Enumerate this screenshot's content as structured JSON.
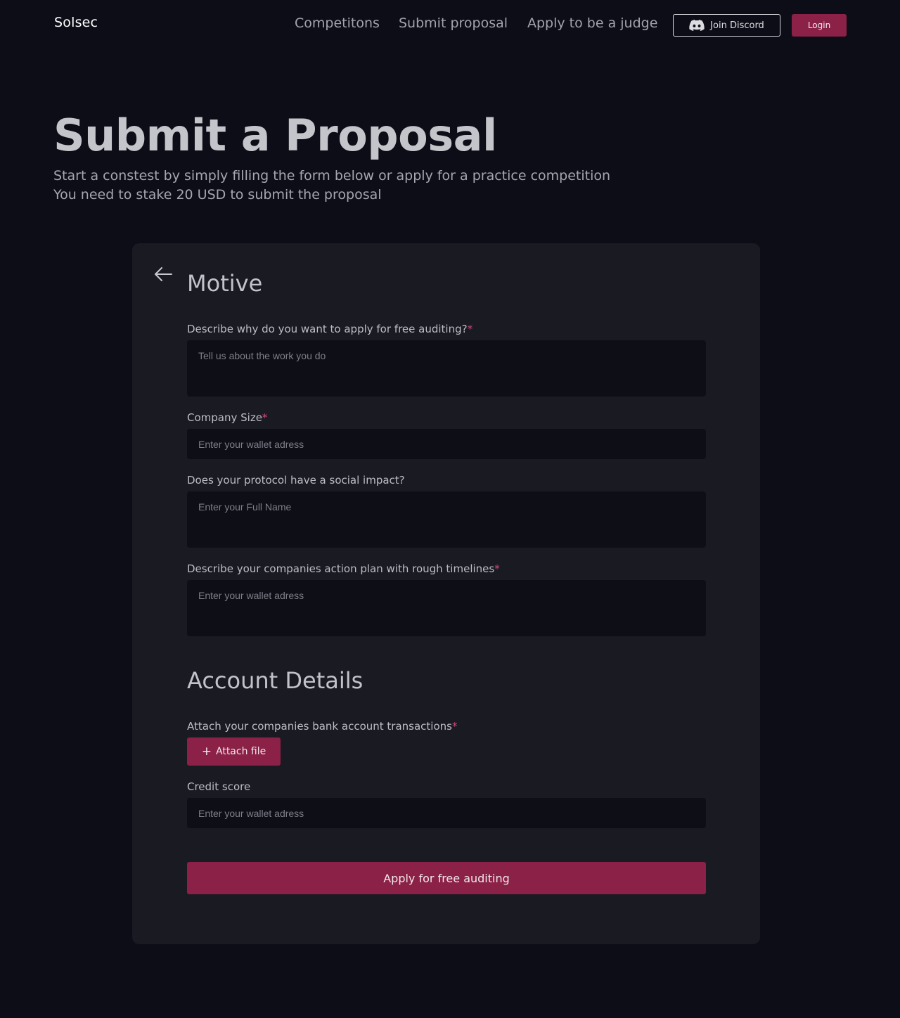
{
  "header": {
    "brand": "Solsec",
    "nav": [
      "Competitons",
      "Submit proposal",
      "Apply to be a judge"
    ],
    "discord_label": "Join Discord",
    "login_label": "Login"
  },
  "hero": {
    "title": "Submit a Proposal",
    "subtitle_line1": "Start a constest by simply filling the form below or apply for a practice competition",
    "subtitle_line2": "You need to stake 20 USD to submit the proposal"
  },
  "form": {
    "motive_title": "Motive",
    "fields": [
      {
        "label": "Describe why do you want to apply for free auditing?",
        "required": "*",
        "placeholder": "Tell us about the work you do"
      },
      {
        "label": "Company Size",
        "required": "*",
        "placeholder": "Enter your wallet adress"
      },
      {
        "label": "Does your protocol have a social impact?",
        "required": "",
        "placeholder": "Enter your Full Name"
      },
      {
        "label": "Describe your companies action plan with rough timelines",
        "required": "*",
        "placeholder": "Enter your wallet adress"
      }
    ],
    "account_title": "Account Details",
    "attach_label": "Attach your companies bank account transactions",
    "attach_required": "*",
    "attach_button": "Attach file",
    "credit": {
      "label": "Credit score",
      "placeholder": "Enter your wallet adress"
    },
    "submit_label": "Apply for free auditing"
  },
  "colors": {
    "background": "#0d0d17",
    "card": "#1a1a23",
    "accent": "#8b2146",
    "required": "#d14a78"
  }
}
